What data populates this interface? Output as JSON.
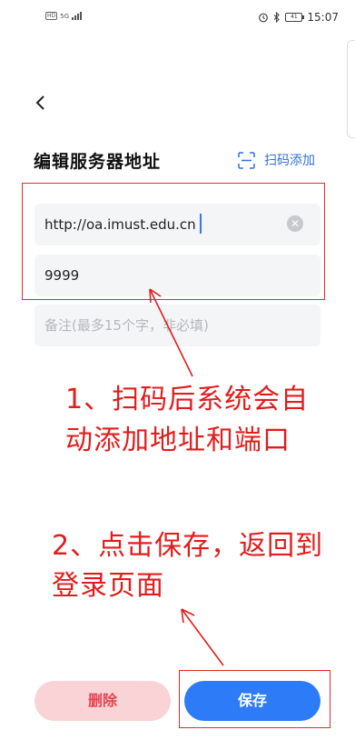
{
  "status_bar": {
    "network_badge": "HD",
    "network_type": "5G",
    "time": "15:07",
    "battery": "41"
  },
  "header": {
    "title": "编辑服务器地址",
    "scan_label": "扫码添加"
  },
  "form": {
    "address_value": "http://oa.imust.edu.cn",
    "port_value": "9999",
    "note_placeholder": "备注(最多15个字，非必填)"
  },
  "annotations": {
    "step1_line1": "1、扫码后系统会自",
    "step1_line2": "动添加地址和端口",
    "step2_line1": "2、点击保存，返回到",
    "step2_line2": "登录页面"
  },
  "actions": {
    "delete_label": "删除",
    "save_label": "保存"
  },
  "colors": {
    "accent": "#2d7bf6",
    "annotation_red": "#e21c1c",
    "delete_bg": "#f9d3d6",
    "delete_text": "#e8414f"
  }
}
